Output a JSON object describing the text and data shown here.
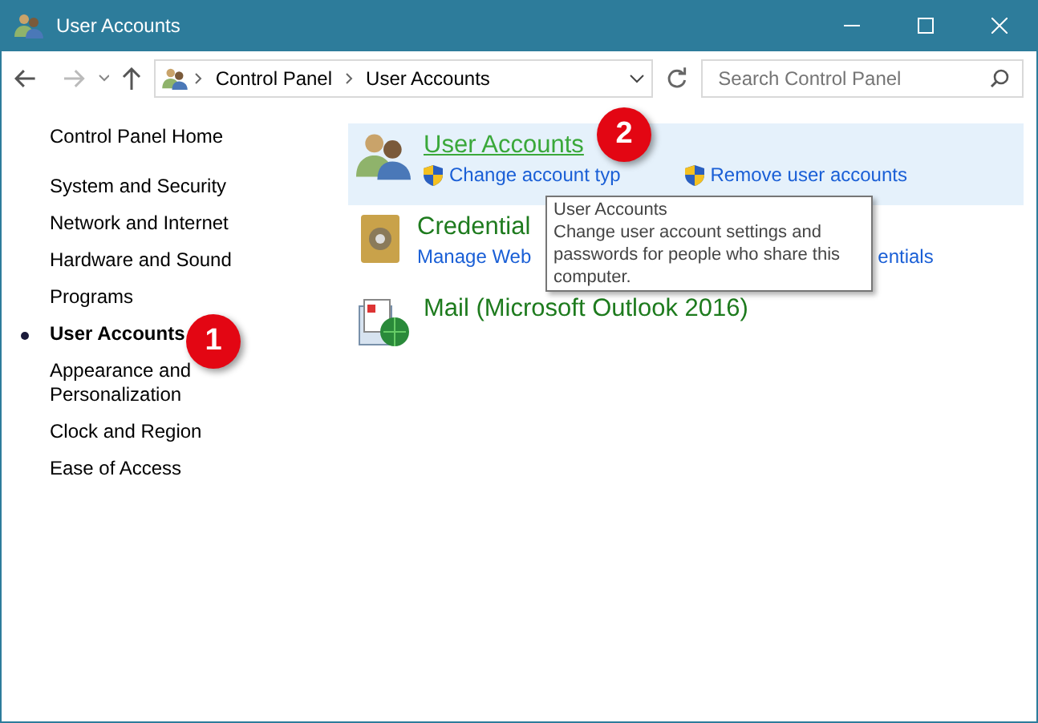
{
  "window": {
    "title": "User Accounts"
  },
  "toolbar": {
    "breadcrumb": [
      "Control Panel",
      "User Accounts"
    ],
    "search": {
      "placeholder": "Search Control Panel"
    }
  },
  "sidebar": {
    "home": "Control Panel Home",
    "items": [
      {
        "label": "System and Security",
        "selected": false
      },
      {
        "label": "Network and Internet",
        "selected": false
      },
      {
        "label": "Hardware and Sound",
        "selected": false
      },
      {
        "label": "Programs",
        "selected": false
      },
      {
        "label": "User Accounts",
        "selected": true
      },
      {
        "label": "Appearance and Personalization",
        "selected": false
      },
      {
        "label": "Clock and Region",
        "selected": false
      },
      {
        "label": "Ease of Access",
        "selected": false
      }
    ]
  },
  "categories": [
    {
      "kind": "users",
      "title": "User Accounts",
      "hovered": true,
      "links": [
        {
          "label": "Change account typ",
          "shield": true
        },
        {
          "label": "Remove user accounts",
          "shield": true
        }
      ]
    },
    {
      "kind": "safe",
      "title": "Credential",
      "hovered": false,
      "links": [
        {
          "label": "Manage Web",
          "shield": false
        },
        {
          "label": "entials",
          "shield": false
        }
      ]
    },
    {
      "kind": "mail",
      "title": "Mail (Microsoft Outlook 2016)",
      "hovered": false
    }
  ],
  "tooltip": {
    "title": "User Accounts",
    "text": "Change user account settings and passwords for people who share this computer."
  },
  "callouts": [
    "1",
    "2"
  ]
}
